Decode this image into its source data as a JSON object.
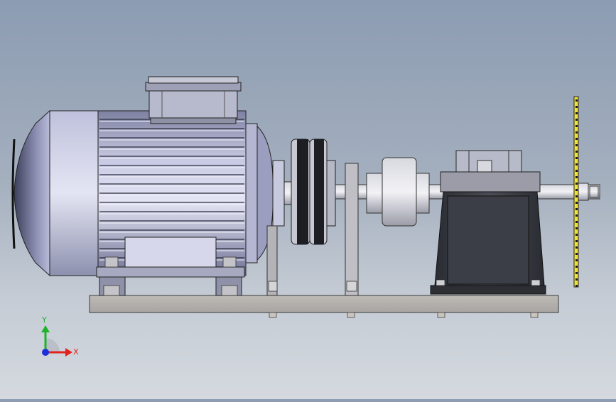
{
  "viewport": {
    "background_top": "#8c9cb2",
    "background_bottom": "#d5d9df"
  },
  "model": {
    "parts": [
      "motor",
      "terminal-box",
      "motor-feet",
      "coupling-disc",
      "bearing-support",
      "shaft",
      "flywheel",
      "gearbox-housing",
      "saw-blade",
      "base-plate"
    ]
  },
  "triad": {
    "x_label": "X",
    "y_label": "Y",
    "x_color": "#e0231e",
    "y_color": "#1fb32a",
    "z_color": "#1d2fd8"
  }
}
